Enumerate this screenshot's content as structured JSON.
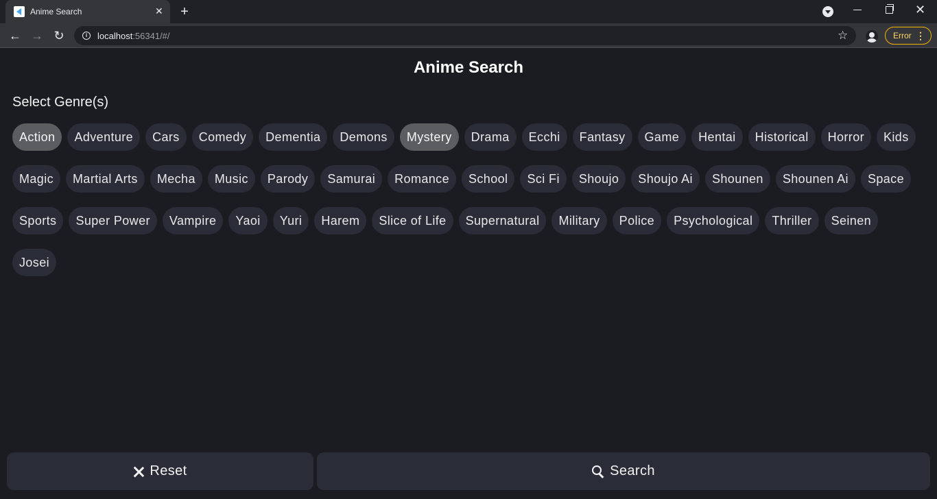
{
  "browser": {
    "tab_title": "Anime Search",
    "tab_close": "✕",
    "new_tab": "+",
    "url_host": "localhost",
    "url_rest": ":56341/#/",
    "error_label": "Error",
    "menu_dots": "⋮",
    "accent_error": "#f2b600"
  },
  "page": {
    "title": "Anime Search",
    "section_label": "Select Genre(s)"
  },
  "genres": [
    {
      "label": "Action",
      "selected": true
    },
    {
      "label": "Adventure",
      "selected": false
    },
    {
      "label": "Cars",
      "selected": false
    },
    {
      "label": "Comedy",
      "selected": false
    },
    {
      "label": "Dementia",
      "selected": false
    },
    {
      "label": "Demons",
      "selected": false
    },
    {
      "label": "Mystery",
      "selected": true
    },
    {
      "label": "Drama",
      "selected": false
    },
    {
      "label": "Ecchi",
      "selected": false
    },
    {
      "label": "Fantasy",
      "selected": false
    },
    {
      "label": "Game",
      "selected": false
    },
    {
      "label": "Hentai",
      "selected": false
    },
    {
      "label": "Historical",
      "selected": false
    },
    {
      "label": "Horror",
      "selected": false
    },
    {
      "label": "Kids",
      "selected": false
    },
    {
      "label": "Magic",
      "selected": false
    },
    {
      "label": "Martial Arts",
      "selected": false
    },
    {
      "label": "Mecha",
      "selected": false
    },
    {
      "label": "Music",
      "selected": false
    },
    {
      "label": "Parody",
      "selected": false
    },
    {
      "label": "Samurai",
      "selected": false
    },
    {
      "label": "Romance",
      "selected": false
    },
    {
      "label": "School",
      "selected": false
    },
    {
      "label": "Sci Fi",
      "selected": false
    },
    {
      "label": "Shoujo",
      "selected": false
    },
    {
      "label": "Shoujo Ai",
      "selected": false
    },
    {
      "label": "Shounen",
      "selected": false
    },
    {
      "label": "Shounen Ai",
      "selected": false
    },
    {
      "label": "Space",
      "selected": false
    },
    {
      "label": "Sports",
      "selected": false
    },
    {
      "label": "Super Power",
      "selected": false
    },
    {
      "label": "Vampire",
      "selected": false
    },
    {
      "label": "Yaoi",
      "selected": false
    },
    {
      "label": "Yuri",
      "selected": false
    },
    {
      "label": "Harem",
      "selected": false
    },
    {
      "label": "Slice of Life",
      "selected": false
    },
    {
      "label": "Supernatural",
      "selected": false
    },
    {
      "label": "Military",
      "selected": false
    },
    {
      "label": "Police",
      "selected": false
    },
    {
      "label": "Psychological",
      "selected": false
    },
    {
      "label": "Thriller",
      "selected": false
    },
    {
      "label": "Seinen",
      "selected": false
    },
    {
      "label": "Josei",
      "selected": false
    }
  ],
  "actions": {
    "reset_label": "Reset",
    "search_label": "Search"
  },
  "colors": {
    "background": "#1b1c22",
    "chip": "#2a2d37",
    "chip_selected": "#5c5d61"
  }
}
